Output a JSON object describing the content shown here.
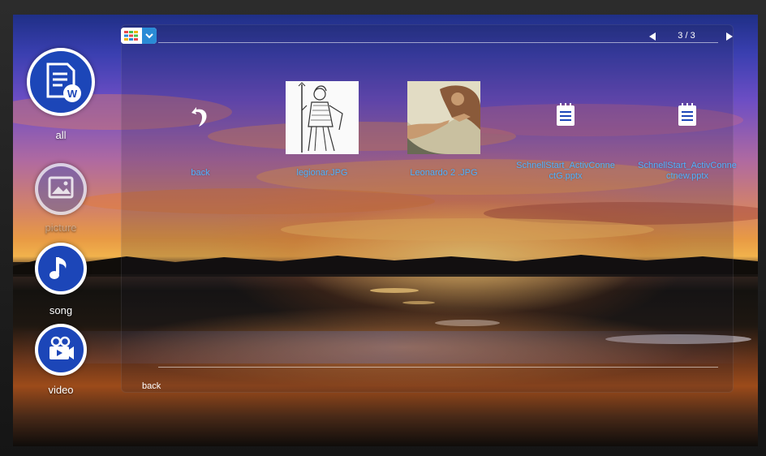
{
  "sidebar": {
    "items": [
      {
        "label": "all",
        "icon": "document-icon"
      },
      {
        "label": "picture",
        "icon": "picture-icon"
      },
      {
        "label": "song",
        "icon": "music-note-icon"
      },
      {
        "label": "video",
        "icon": "video-camera-icon"
      }
    ]
  },
  "toolbar": {
    "view_toggle_icon": "grid-view-icon",
    "dropdown_icon": "chevron-down-icon"
  },
  "pager": {
    "prev_icon": "triangle-left-icon",
    "text": "3 / 3",
    "next_icon": "triangle-right-icon"
  },
  "files": [
    {
      "name": "back",
      "icon": "back-arrow-icon"
    },
    {
      "name": "legionar.JPG",
      "icon": "image-thumbnail"
    },
    {
      "name": "Leonardo 2 .JPG",
      "icon": "image-thumbnail"
    },
    {
      "name": "SchnellStart_ActivConnectG.pptx",
      "name_line1": "SchnellStart_ActivConne",
      "name_line2": "ctG.pptx",
      "icon": "document-file-icon"
    },
    {
      "name": "SchnellStart_ActivConnectnew.pptx",
      "name_line1": "SchnellStart_ActivConne",
      "name_line2": "ctnew.pptx",
      "icon": "document-file-icon"
    }
  ],
  "footer": {
    "back_label": "back"
  },
  "colors": {
    "accent": "#4fb3ff",
    "nav_circle": "#1c46b8",
    "toggle_blue": "#2a8bd6"
  }
}
